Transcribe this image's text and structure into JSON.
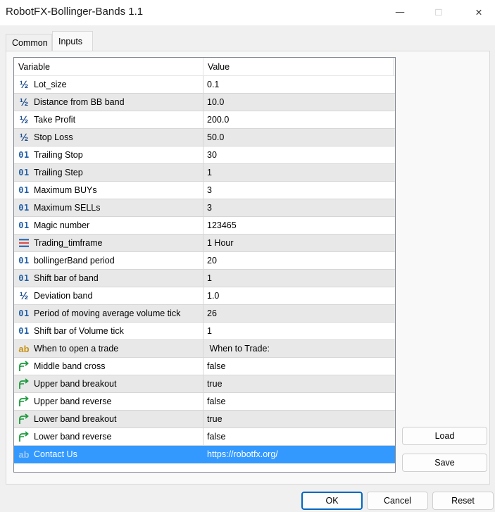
{
  "window": {
    "title": "RobotFX-Bollinger-Bands 1.1",
    "minimize_glyph": "—",
    "maximize_glyph": "☐",
    "close_glyph": "✕"
  },
  "tabs": [
    {
      "label": "Common",
      "active": false
    },
    {
      "label": "Inputs",
      "active": true
    }
  ],
  "grid": {
    "columns": [
      "Variable",
      "Value"
    ],
    "rows": [
      {
        "type": "double",
        "variable": "Lot_size",
        "value": "0.1"
      },
      {
        "type": "double",
        "variable": "Distance from BB band",
        "value": "10.0"
      },
      {
        "type": "double",
        "variable": "Take Profit",
        "value": "200.0"
      },
      {
        "type": "double",
        "variable": "Stop Loss",
        "value": "50.0"
      },
      {
        "type": "int",
        "variable": "Trailing Stop",
        "value": "30"
      },
      {
        "type": "int",
        "variable": "Trailing Step",
        "value": "1"
      },
      {
        "type": "int",
        "variable": "Maximum BUYs",
        "value": "3"
      },
      {
        "type": "int",
        "variable": "Maximum SELLs",
        "value": "3"
      },
      {
        "type": "int",
        "variable": "Magic number",
        "value": "123465"
      },
      {
        "type": "enum",
        "variable": "Trading_timframe",
        "value": "1 Hour"
      },
      {
        "type": "int",
        "variable": "bollingerBand period",
        "value": "20"
      },
      {
        "type": "int",
        "variable": "Shift bar of band",
        "value": "1"
      },
      {
        "type": "double",
        "variable": "Deviation band",
        "value": "1.0"
      },
      {
        "type": "int",
        "variable": "Period of moving average volume tick",
        "value": "26"
      },
      {
        "type": "int",
        "variable": "Shift bar of Volume tick",
        "value": "1"
      },
      {
        "type": "string",
        "variable": "When to open a trade",
        "value": " When to Trade:"
      },
      {
        "type": "bool",
        "variable": "Middle band cross",
        "value": "false"
      },
      {
        "type": "bool",
        "variable": "Upper band breakout",
        "value": "true"
      },
      {
        "type": "bool",
        "variable": "Upper band reverse",
        "value": "false"
      },
      {
        "type": "bool",
        "variable": "Lower band breakout",
        "value": "true"
      },
      {
        "type": "bool",
        "variable": "Lower band reverse",
        "value": "false"
      },
      {
        "type": "string",
        "variable": "Contact Us",
        "value": "https://robotfx.org/",
        "selected": true
      }
    ]
  },
  "icons": {
    "double": "½",
    "int": "01",
    "string": "ab"
  },
  "buttons": {
    "load": "Load",
    "save": "Save",
    "ok": "OK",
    "cancel": "Cancel",
    "reset": "Reset"
  },
  "colors": {
    "selection": "#3399ff",
    "alt_row": "#e8e8e8",
    "ok_border": "#0067c0",
    "bool_icon": "#1a9b3c",
    "enum_icon_red": "#d9534f",
    "enum_icon_blue": "#3a6fb5"
  }
}
